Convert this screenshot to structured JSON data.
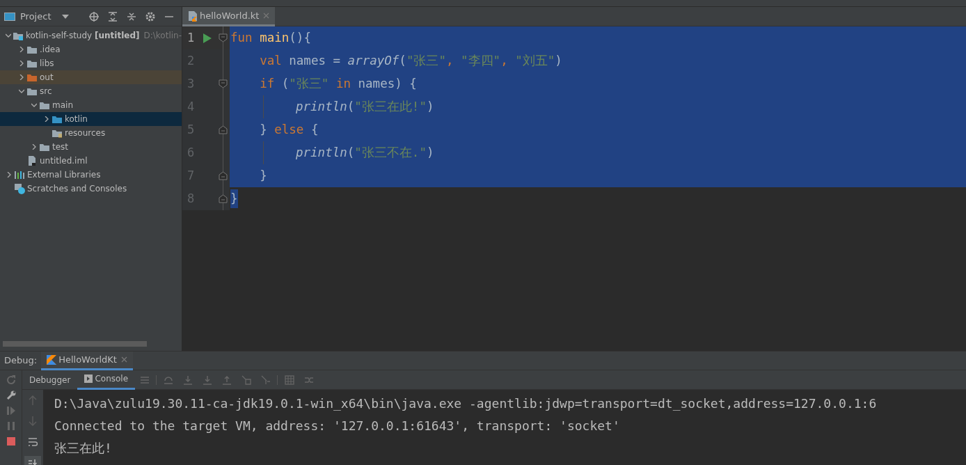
{
  "project_panel": {
    "title": "Project"
  },
  "tree": [
    {
      "label": "kotlin-self-study **[untitled]**",
      "hint": "D:\\kotlin-",
      "kind": "module",
      "expanded": true,
      "selected": false,
      "highlighted": false,
      "children": [
        {
          "label": ".idea",
          "kind": "folder",
          "expanded": false,
          "selected": false,
          "highlighted": false
        },
        {
          "label": "libs",
          "kind": "folder",
          "expanded": false,
          "selected": false,
          "highlighted": false
        },
        {
          "label": "out",
          "kind": "excluded",
          "expanded": false,
          "selected": false,
          "highlighted": true
        },
        {
          "label": "src",
          "kind": "folder",
          "expanded": true,
          "selected": false,
          "highlighted": false,
          "children": [
            {
              "label": "main",
              "kind": "folder",
              "expanded": true,
              "selected": false,
              "highlighted": false,
              "children": [
                {
                  "label": "kotlin",
                  "kind": "source",
                  "expanded": false,
                  "selected": true,
                  "highlighted": false
                },
                {
                  "label": "resources",
                  "kind": "resources",
                  "selected": false,
                  "highlighted": false
                }
              ]
            },
            {
              "label": "test",
              "kind": "folder",
              "expanded": false,
              "selected": false,
              "highlighted": false
            }
          ]
        },
        {
          "label": "untitled.iml",
          "kind": "file",
          "selected": false,
          "highlighted": false
        }
      ]
    },
    {
      "label": "External Libraries",
      "kind": "libraries",
      "expanded": false,
      "selected": false,
      "highlighted": false
    },
    {
      "label": "Scratches and Consoles",
      "kind": "scratches",
      "selected": false,
      "highlighted": false
    }
  ],
  "editor": {
    "tabs": [
      {
        "label": "helloWorld.kt",
        "selected": true
      }
    ],
    "lines": [
      {
        "number": "1",
        "current": true,
        "run": true,
        "fold_start": true,
        "fold_end": false,
        "guide": false,
        "selected": true,
        "selected_to_end": true,
        "tokens": [
          {
            "text": "fun ",
            "kind": "keyword"
          },
          {
            "text": "main",
            "kind": "declaration"
          },
          {
            "text": "(){",
            "kind": "plain"
          }
        ]
      },
      {
        "number": "2",
        "current": false,
        "run": false,
        "fold_start": false,
        "fold_end": false,
        "guide": false,
        "selected": true,
        "selected_to_end": true,
        "tokens": [
          {
            "text": "    val",
            "kind": "keyword"
          },
          {
            "text": " names = ",
            "kind": "plain"
          },
          {
            "text": "arrayOf",
            "kind": "call"
          },
          {
            "text": "(",
            "kind": "plain"
          },
          {
            "text": "\"张三\"",
            "kind": "string"
          },
          {
            "text": ", ",
            "kind": "keyword"
          },
          {
            "text": "\"李四\"",
            "kind": "string"
          },
          {
            "text": ", ",
            "kind": "keyword"
          },
          {
            "text": "\"刘五\"",
            "kind": "string"
          },
          {
            "text": ")",
            "kind": "plain"
          }
        ]
      },
      {
        "number": "3",
        "current": false,
        "run": false,
        "fold_start": true,
        "fold_end": false,
        "guide": false,
        "selected": true,
        "selected_to_end": true,
        "tokens": [
          {
            "text": "    if",
            "kind": "keyword"
          },
          {
            "text": " (",
            "kind": "plain"
          },
          {
            "text": "\"张三\"",
            "kind": "string"
          },
          {
            "text": " in",
            "kind": "keyword"
          },
          {
            "text": " names) {",
            "kind": "plain"
          }
        ]
      },
      {
        "number": "4",
        "current": false,
        "run": false,
        "fold_start": false,
        "fold_end": false,
        "guide": true,
        "selected": true,
        "selected_to_end": true,
        "tokens": [
          {
            "text": "println",
            "kind": "call"
          },
          {
            "text": "(",
            "kind": "plain"
          },
          {
            "text": "\"张三在此!\"",
            "kind": "string"
          },
          {
            "text": ")",
            "kind": "plain"
          }
        ]
      },
      {
        "number": "5",
        "current": false,
        "run": false,
        "fold_start": false,
        "fold_end": true,
        "guide": false,
        "selected": true,
        "selected_to_end": true,
        "tokens": [
          {
            "text": "    } ",
            "kind": "plain"
          },
          {
            "text": "else",
            "kind": "keyword"
          },
          {
            "text": " {",
            "kind": "plain"
          }
        ]
      },
      {
        "number": "6",
        "current": false,
        "run": false,
        "fold_start": false,
        "fold_end": false,
        "guide": true,
        "selected": true,
        "selected_to_end": true,
        "tokens": [
          {
            "text": "println",
            "kind": "call"
          },
          {
            "text": "(",
            "kind": "plain"
          },
          {
            "text": "\"张三不在.\"",
            "kind": "string"
          },
          {
            "text": ")",
            "kind": "plain"
          }
        ]
      },
      {
        "number": "7",
        "current": false,
        "run": false,
        "fold_start": false,
        "fold_end": true,
        "guide": false,
        "selected": true,
        "selected_to_end": true,
        "tokens": [
          {
            "text": "    }",
            "kind": "plain"
          }
        ]
      },
      {
        "number": "8",
        "current": false,
        "run": false,
        "fold_start": false,
        "fold_end": true,
        "guide": false,
        "selected": true,
        "selected_to_end": false,
        "tokens": [
          {
            "text": "}",
            "kind": "plain"
          }
        ]
      }
    ]
  },
  "debug_panel": {
    "label": "Debug:",
    "tabs": [
      {
        "label": "HelloWorldKt",
        "selected": true
      }
    ],
    "subtabs": [
      {
        "label": "Debugger",
        "selected": false
      },
      {
        "label": "Console",
        "selected": true
      }
    ],
    "console": [
      "D:\\Java\\zulu19.30.11-ca-jdk19.0.1-win_x64\\bin\\java.exe -agentlib:jdwp=transport=dt_socket,address=127.0.0.1:6",
      "Connected to the target VM, address: '127.0.0.1:61643', transport: 'socket'",
      "张三在此!"
    ]
  }
}
